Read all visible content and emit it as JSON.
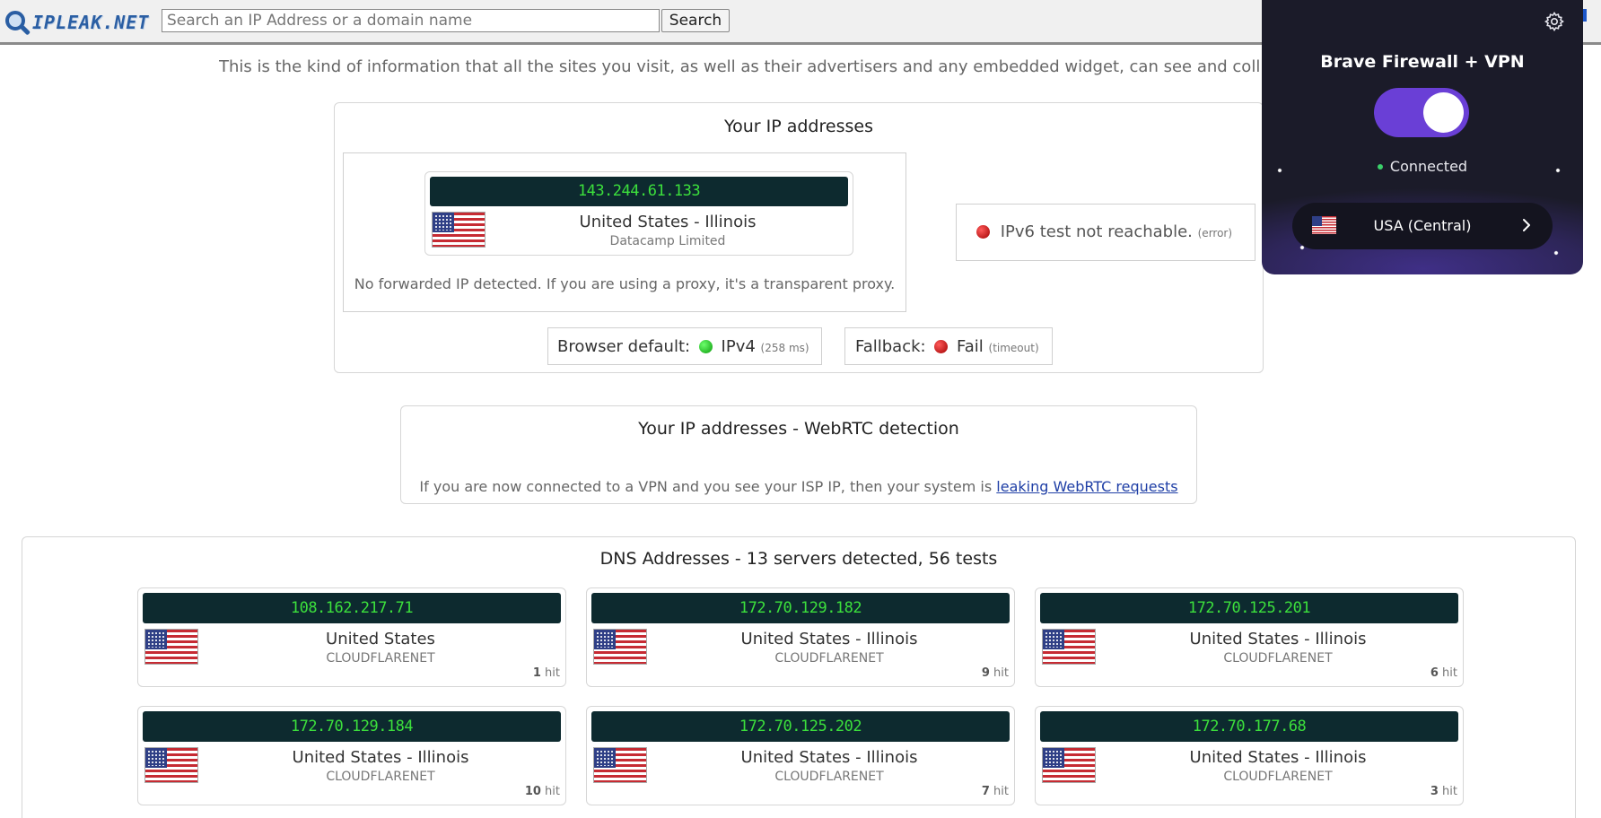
{
  "header": {
    "logo_text": "IPLEAK.NET",
    "search_placeholder": "Search an IP Address or a domain name",
    "search_button": "Search"
  },
  "intro_text": "This is the kind of information that all the sites you visit, as well as their advertisers and any embedded widget, can see and collect",
  "ip_section": {
    "title": "Your IP addresses",
    "ipv4": {
      "ip": "143.244.61.133",
      "location": "United States - Illinois",
      "isp": "Datacamp Limited"
    },
    "forwarded_note": "No forwarded IP detected. If you are using a proxy, it's a transparent proxy.",
    "ipv6": {
      "text": "IPv6 test not reachable.",
      "note": "(error)"
    },
    "browser_default": {
      "label": "Browser default:",
      "value": "IPv4",
      "note": "(258 ms)"
    },
    "fallback": {
      "label": "Fallback:",
      "value": "Fail",
      "note": "(timeout)"
    }
  },
  "webrtc_section": {
    "title": "Your IP addresses - WebRTC detection",
    "note": "If you are now connected to a VPN and you see your ISP IP, then your system is",
    "link": "leaking WebRTC requests"
  },
  "dns_section": {
    "title": "DNS Addresses - 13 servers detected, 56 tests",
    "servers": [
      {
        "ip": "108.162.217.71",
        "location": "United States",
        "isp": "CLOUDFLARENET",
        "hits": "1",
        "hit_label": "hit"
      },
      {
        "ip": "172.70.129.182",
        "location": "United States - Illinois",
        "isp": "CLOUDFLARENET",
        "hits": "9",
        "hit_label": "hit"
      },
      {
        "ip": "172.70.125.201",
        "location": "United States - Illinois",
        "isp": "CLOUDFLARENET",
        "hits": "6",
        "hit_label": "hit"
      },
      {
        "ip": "172.70.129.184",
        "location": "United States - Illinois",
        "isp": "CLOUDFLARENET",
        "hits": "10",
        "hit_label": "hit"
      },
      {
        "ip": "172.70.125.202",
        "location": "United States - Illinois",
        "isp": "CLOUDFLARENET",
        "hits": "7",
        "hit_label": "hit"
      },
      {
        "ip": "172.70.177.68",
        "location": "United States - Illinois",
        "isp": "CLOUDFLARENET",
        "hits": "3",
        "hit_label": "hit"
      }
    ]
  },
  "vpn_panel": {
    "title": "Brave Firewall + VPN",
    "toggle_on": true,
    "status": "Connected",
    "region": "USA (Central)",
    "accent_color": "#6a3fd6",
    "status_color": "#3bd06a"
  },
  "icons": {
    "gear": "gear-icon",
    "chevron": "chevron-right-icon",
    "flag": "us-flag-icon"
  }
}
